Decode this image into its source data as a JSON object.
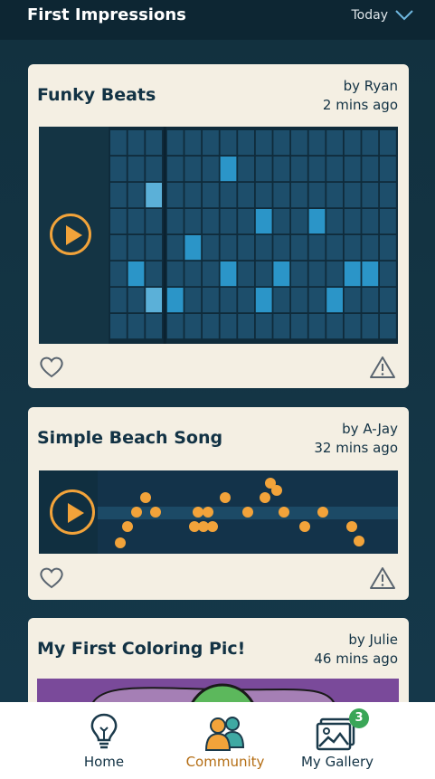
{
  "header": {
    "title": "First Impressions",
    "filter_label": "Today"
  },
  "posts": [
    {
      "title": "Funky Beats",
      "author": "by Ryan",
      "time": "2 mins ago"
    },
    {
      "title": "Simple Beach Song",
      "author": "by A-Jay",
      "time": "32 mins ago"
    },
    {
      "title": "My First Coloring Pic!",
      "author": "by Julie",
      "time": "46 mins ago"
    }
  ],
  "nav": {
    "home": "Home",
    "community": "Community",
    "gallery": "My Gallery",
    "gallery_badge": "3"
  },
  "colors": {
    "accent": "#f2a33a",
    "card": "#f4efe3",
    "cell": "#1d4e6b",
    "cell_on": "#2b95c8",
    "cell_light": "#5bb0d8"
  }
}
